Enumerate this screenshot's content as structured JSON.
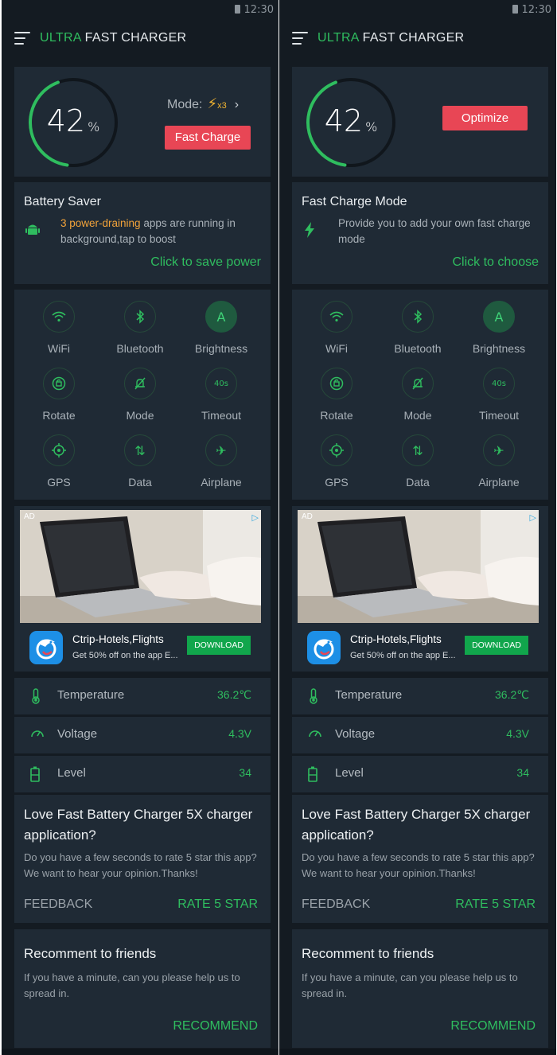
{
  "status_bar": {
    "time": "12:30"
  },
  "app": {
    "title_accent": "ULTRA",
    "title_rest": "FAST CHARGER"
  },
  "colors": {
    "background": "#141b22",
    "card": "#1f2a35",
    "accent_green": "#2fbd5f",
    "alert_red": "#e84655",
    "warning_orange": "#f2a33a"
  },
  "screens": [
    {
      "battery": {
        "percent": "42",
        "percent_unit": "%",
        "level_fraction": 0.42,
        "mode_label": "Mode:",
        "mode_multiplier": "x3",
        "button_label": "Fast Charge"
      },
      "info_card": {
        "title": "Battery Saver",
        "icon": "android-icon",
        "highlight": "3 power-draining",
        "text": " apps are running in background,tap to boost",
        "action": "Click to save power"
      }
    },
    {
      "battery": {
        "percent": "42",
        "percent_unit": "%",
        "level_fraction": 0.42,
        "button_label": "Optimize"
      },
      "info_card": {
        "title": "Fast Charge Mode",
        "icon": "lightning-icon",
        "text": "Provide you to add your own fast charge mode",
        "action": "Click to choose"
      }
    }
  ],
  "toggles": [
    {
      "label": "WiFi",
      "icon": "wifi-icon",
      "active": false
    },
    {
      "label": "Bluetooth",
      "icon": "bluetooth-icon",
      "active": false
    },
    {
      "label": "Brightness",
      "icon": "brightness-icon",
      "glyph": "A",
      "active": true
    },
    {
      "label": "Rotate",
      "icon": "rotate-icon",
      "active": false
    },
    {
      "label": "Mode",
      "icon": "silent-mode-icon",
      "active": false
    },
    {
      "label": "Timeout",
      "icon": "timeout-icon",
      "glyph": "40s",
      "active": false
    },
    {
      "label": "GPS",
      "icon": "gps-icon",
      "active": false
    },
    {
      "label": "Data",
      "icon": "data-icon",
      "glyph": "⇅",
      "active": false
    },
    {
      "label": "Airplane",
      "icon": "airplane-icon",
      "glyph": "✈",
      "active": false
    }
  ],
  "ad": {
    "tag": "AD",
    "app_name": "Ctrip-Hotels,Flights",
    "description": "Get 50% off on the app E...",
    "button": "DOWNLOAD",
    "icon": "dolphin-app-icon"
  },
  "stats": [
    {
      "label": "Temperature",
      "value": "36.2℃",
      "icon": "thermometer-icon"
    },
    {
      "label": "Voltage",
      "value": "4.3V",
      "icon": "gauge-icon"
    },
    {
      "label": "Level",
      "value": "34",
      "icon": "battery-icon"
    }
  ],
  "rate": {
    "title": "Love Fast Battery Charger 5X charger application?",
    "text": "Do you have a few seconds to rate 5 star this app? We want to hear your opinion.Thanks!",
    "feedback": "FEEDBACK",
    "rate_button": "RATE 5 STAR"
  },
  "recommend": {
    "title": "Recomment to friends",
    "text": "If you have a minute, can you please help us to spread in.",
    "button": "RECOMMEND"
  }
}
